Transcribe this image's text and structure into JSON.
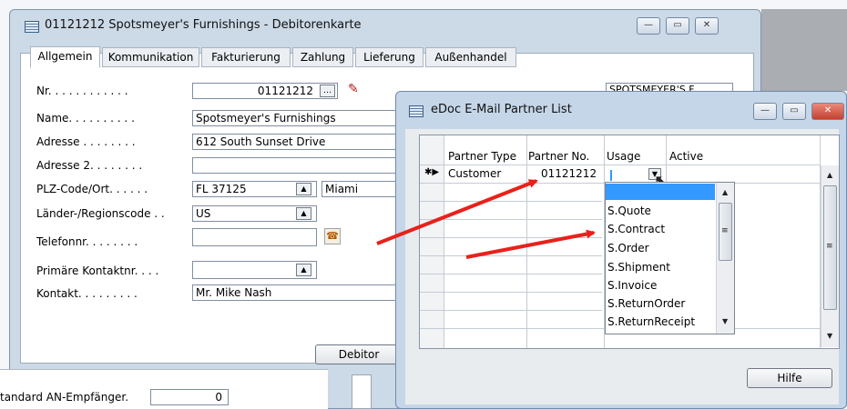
{
  "main_window": {
    "title": "01121212 Spotsmeyer's Furnishings - Debitorenkarte",
    "tabs": [
      "Allgemein",
      "Kommunikation",
      "Fakturierung",
      "Zahlung",
      "Lieferung",
      "Außenhandel"
    ],
    "fields": {
      "nr_label": "Nr. . . . . . . . . . . .",
      "nr_value": "01121212",
      "name_label": "Name. . . . . . . . . .",
      "name_value": "Spotsmeyer's Furnishings",
      "adresse_label": "Adresse . . . . . . . .",
      "adresse_value": "612 South Sunset Drive",
      "adresse2_label": "Adresse 2. . . . . . . .",
      "adresse2_value": "",
      "plz_label": "PLZ-Code/Ort. . . . . .",
      "plz_value": "FL 37125",
      "ort_value": "Miami",
      "land_label": "Länder-/Regionscode . .",
      "land_value": "US",
      "telefon_label": "Telefonnr. . . . . . . .",
      "telefon_value": "",
      "kontaktnr_label": "Primäre Kontaktnr. . . .",
      "kontaktnr_value": "",
      "kontakt_label": "Kontakt. . . . . . . . .",
      "kontakt_value": "Mr. Mike Nash",
      "suchbegriff_value": "SPOTSMEYER'S F"
    },
    "debitor_button": "Debitor",
    "standard_label": "tandard AN-Empfänger.",
    "standard_value": "0"
  },
  "edoc_window": {
    "title": "eDoc E-Mail Partner List",
    "columns": [
      "Partner Type",
      "Partner No.",
      "Usage",
      "Active"
    ],
    "row_marker": "✱▶",
    "row": {
      "partner_type": "Customer",
      "partner_no": "01121212",
      "usage": ""
    },
    "usage_options": [
      "",
      "S.Quote",
      "S.Contract",
      "S.Order",
      "S.Shipment",
      "S.Invoice",
      "S.ReturnOrder",
      "S.ReturnReceipt"
    ],
    "hilfe_button": "Hilfe"
  },
  "colors": {
    "arrow": "#e8211b",
    "selection": "#3399ff",
    "title_red": "#c9402e"
  }
}
